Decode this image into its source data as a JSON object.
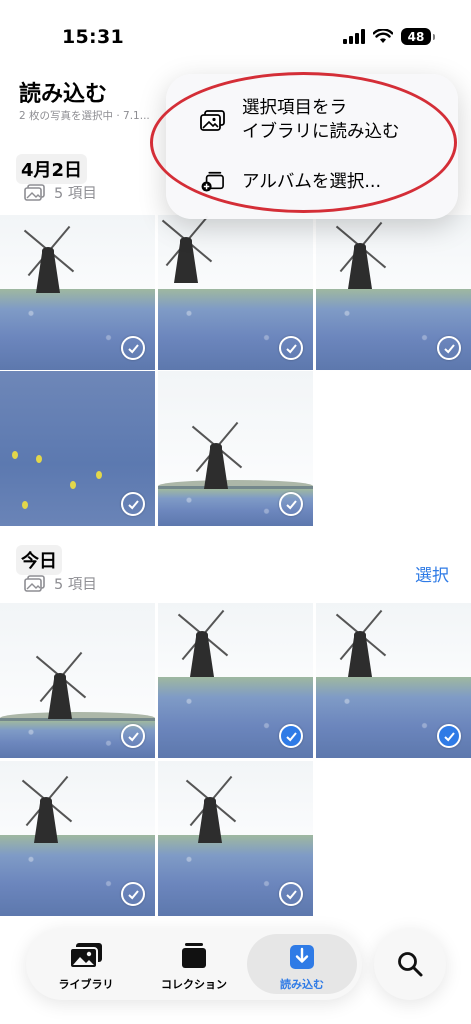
{
  "status_bar": {
    "time": "15:31",
    "battery": "48"
  },
  "header": {
    "title": "読み込む",
    "subtitle": "2 枚の写真を選択中 · 7.1..."
  },
  "sections": [
    {
      "date": "4月2日",
      "count": "5 項目"
    },
    {
      "date": "今日",
      "count": "5 項目",
      "select_label": "選択"
    }
  ],
  "photos": {
    "section1": [
      {
        "selected": false
      },
      {
        "selected": false
      },
      {
        "selected": false
      },
      {
        "selected": false
      },
      {
        "selected": false
      }
    ],
    "section2": [
      {
        "selected": false
      },
      {
        "selected": true
      },
      {
        "selected": true
      },
      {
        "selected": false
      },
      {
        "selected": false
      }
    ]
  },
  "menu": {
    "import_selected": "選択項目をラ\nイブラリに読み込む",
    "select_album": "アルバムを選択..."
  },
  "tabbar": {
    "tabs": [
      {
        "label": "ライブラリ",
        "icon": "photos-icon"
      },
      {
        "label": "コレクション",
        "icon": "collections-icon"
      },
      {
        "label": "読み込む",
        "icon": "import-icon",
        "active": true
      }
    ],
    "search_icon": "search-icon"
  },
  "colors": {
    "accent": "#2f7be6",
    "annotation": "#d42e37"
  }
}
